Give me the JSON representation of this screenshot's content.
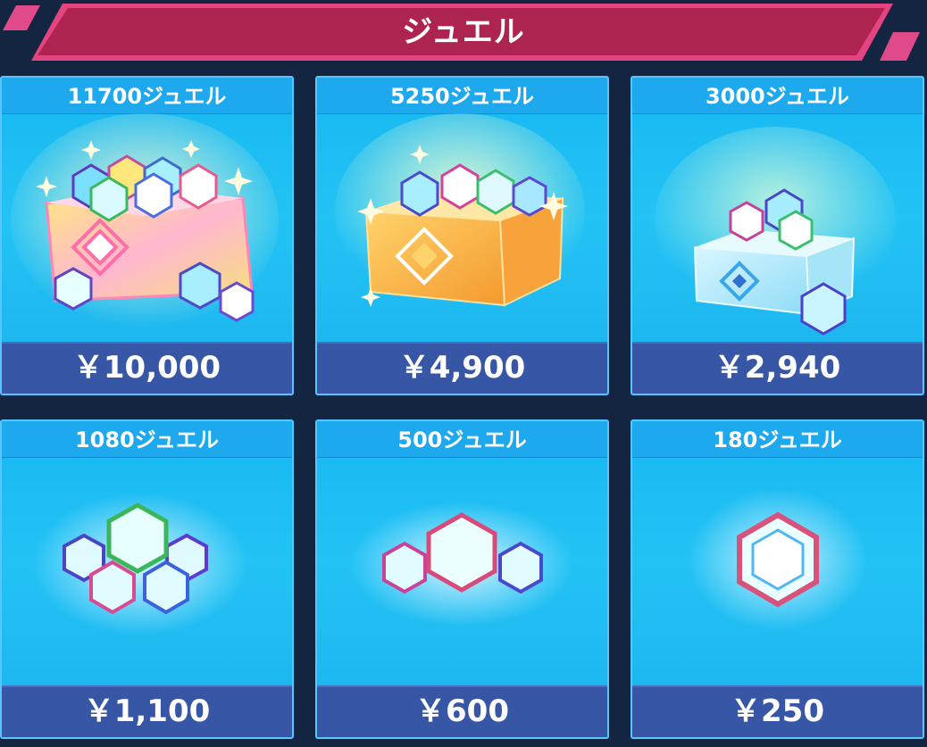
{
  "header": {
    "title": "ジュエル"
  },
  "products": [
    {
      "title": "11700ジュエル",
      "price": "￥10,000",
      "art": "pink-crystal-box-icon"
    },
    {
      "title": "5250ジュエル",
      "price": "￥4,900",
      "art": "gold-crystal-box-icon"
    },
    {
      "title": "3000ジュエル",
      "price": "￥2,940",
      "art": "ice-crystal-box-icon"
    },
    {
      "title": "1080ジュエル",
      "price": "￥1,100",
      "art": "jewel-pile-five-icon"
    },
    {
      "title": "500ジュエル",
      "price": "￥600",
      "art": "jewel-pile-three-icon"
    },
    {
      "title": "180ジュエル",
      "price": "￥250",
      "art": "single-jewel-icon"
    }
  ],
  "colors": {
    "background": "#132540",
    "header": "#b0264f",
    "card": "#1fb9f3",
    "price_bar": "#3856a6"
  }
}
